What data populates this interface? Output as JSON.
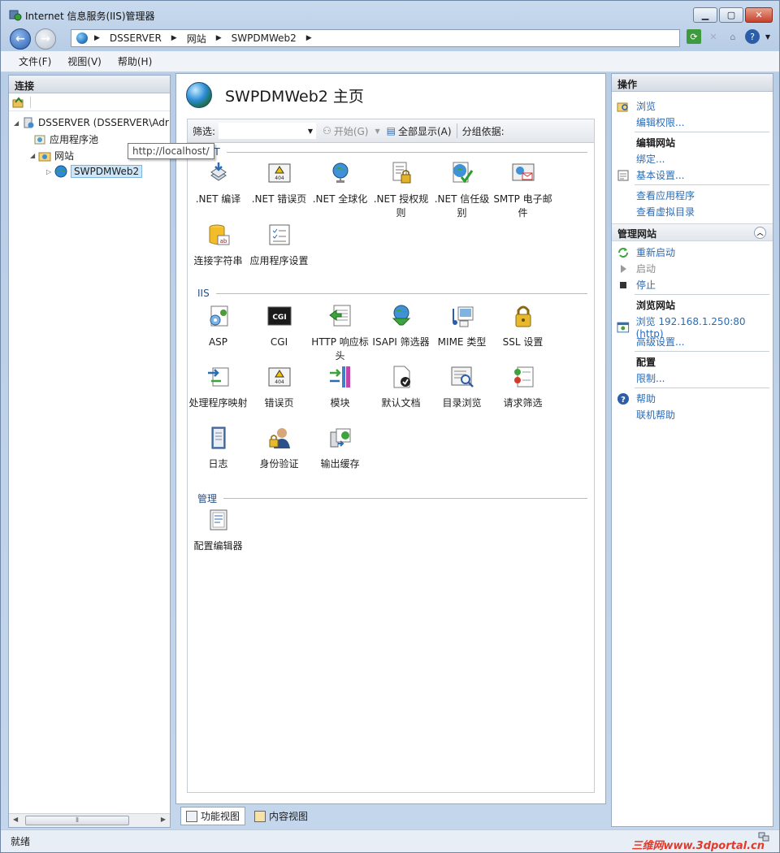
{
  "window": {
    "title": "Internet 信息服务(IIS)管理器"
  },
  "address": {
    "crumbs": [
      "DSSERVER",
      "网站",
      "SWPDMWeb2"
    ]
  },
  "menu": [
    "文件(F)",
    "视图(V)",
    "帮助(H)"
  ],
  "connections": {
    "title": "连接",
    "tree": {
      "server": "DSSERVER (DSSERVER\\Adr",
      "app_pools": "应用程序池",
      "sites": "网站",
      "site": "SWPDMWeb2"
    },
    "tooltip": "http://localhost/"
  },
  "main": {
    "title": "SWPDMWeb2 主页",
    "filter_label": "筛选:",
    "start_label": "开始(G)",
    "show_all_label": "全部显示(A)",
    "group_by_label": "分组依据:",
    "groups": {
      "aspnet": ".NET",
      "iis": "IIS",
      "manage": "管理"
    },
    "features": {
      "net_compile": ".NET 编译",
      "net_error_pages": ".NET 错误页",
      "net_globalization": ".NET 全球化",
      "net_auth_rules": ".NET 授权规则",
      "net_trust_levels": ".NET 信任级别",
      "smtp_email": "SMTP 电子邮件",
      "conn_strings": "连接字符串",
      "app_settings": "应用程序设置",
      "asp": "ASP",
      "cgi": "CGI",
      "http_headers": "HTTP 响应标头",
      "isapi_filters": "ISAPI 筛选器",
      "mime_types": "MIME 类型",
      "ssl_settings": "SSL 设置",
      "handler_mappings": "处理程序映射",
      "error_pages": "错误页",
      "modules": "模块",
      "default_document": "默认文档",
      "dir_browsing": "目录浏览",
      "request_filtering": "请求筛选",
      "logging": "日志",
      "authentication": "身份验证",
      "output_cache": "输出缓存",
      "config_editor": "配置编辑器"
    },
    "tabs": {
      "features_view": "功能视图",
      "content_view": "内容视图"
    }
  },
  "actions": {
    "title": "操作",
    "browse": "浏览",
    "edit_permissions": "编辑权限...",
    "edit_site": "编辑网站",
    "bindings": "绑定...",
    "basic_settings": "基本设置...",
    "view_apps": "查看应用程序",
    "view_vdirs": "查看虚拟目录",
    "manage_site": "管理网站",
    "restart": "重新启动",
    "start": "启动",
    "stop": "停止",
    "browse_site": "浏览网站",
    "browse_url": "浏览 192.168.1.250:80 (http)",
    "advanced_settings": "高级设置...",
    "configure": "配置",
    "limits": "限制...",
    "help": "帮助",
    "online_help": "联机帮助"
  },
  "status": {
    "text": "就绪",
    "watermark": "三维网www.3dportal.cn"
  }
}
